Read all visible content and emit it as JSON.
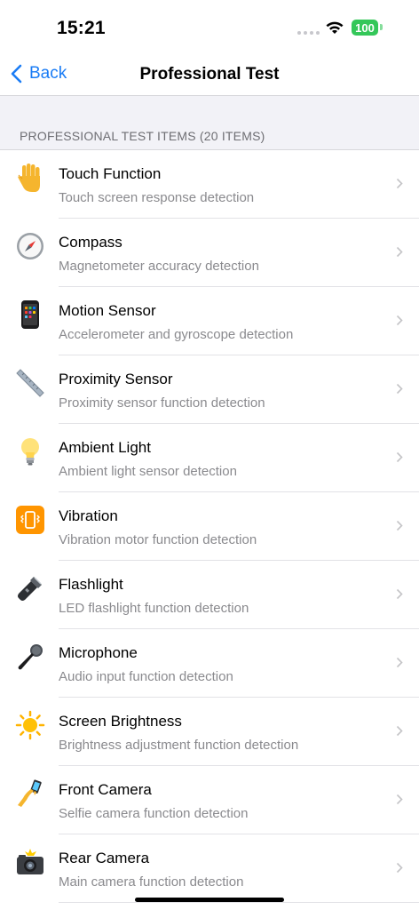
{
  "status": {
    "time": "15:21",
    "battery": "100"
  },
  "nav": {
    "back_label": "Back",
    "title": "Professional Test"
  },
  "section": {
    "header": "PROFESSIONAL TEST ITEMS (20 ITEMS)"
  },
  "items": [
    {
      "title": "Touch Function",
      "subtitle": "Touch screen response detection",
      "icon": "hand-icon"
    },
    {
      "title": "Compass",
      "subtitle": "Magnetometer accuracy detection",
      "icon": "compass-icon"
    },
    {
      "title": "Motion Sensor",
      "subtitle": "Accelerometer and gyroscope detection",
      "icon": "phone-icon"
    },
    {
      "title": "Proximity Sensor",
      "subtitle": "Proximity sensor function detection",
      "icon": "ruler-icon"
    },
    {
      "title": "Ambient Light",
      "subtitle": "Ambient light sensor detection",
      "icon": "light-bulb-icon"
    },
    {
      "title": "Vibration",
      "subtitle": "Vibration motor function detection",
      "icon": "vibration-mode-icon"
    },
    {
      "title": "Flashlight",
      "subtitle": "LED flashlight function detection",
      "icon": "flashlight-icon"
    },
    {
      "title": "Microphone",
      "subtitle": "Audio input function detection",
      "icon": "microphone-icon"
    },
    {
      "title": "Screen Brightness",
      "subtitle": "Brightness adjustment function detection",
      "icon": "sun-icon"
    },
    {
      "title": "Front Camera",
      "subtitle": "Selfie camera function detection",
      "icon": "selfie-icon"
    },
    {
      "title": "Rear Camera",
      "subtitle": "Main camera function detection",
      "icon": "camera-flash-icon"
    }
  ]
}
